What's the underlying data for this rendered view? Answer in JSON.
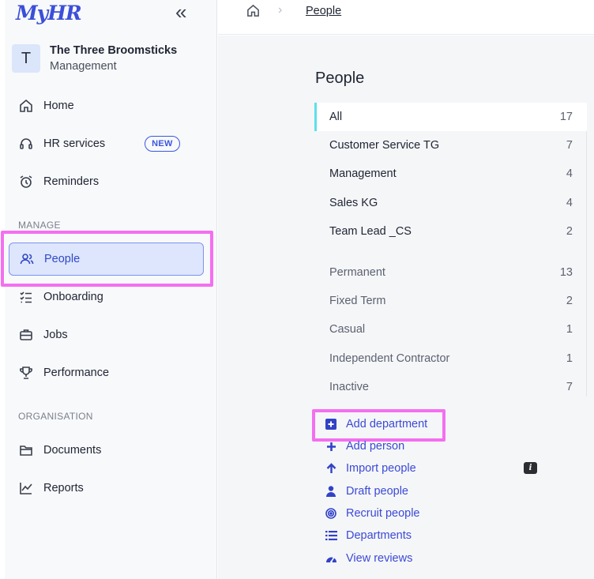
{
  "app": {
    "logo": "MyHR",
    "accent": "#3b4fd9"
  },
  "org": {
    "initial": "T",
    "name": "The Three Broomsticks",
    "role": "Management"
  },
  "nav": {
    "primary": [
      {
        "label": "Home",
        "icon": "home-icon"
      },
      {
        "label": "HR services",
        "icon": "headset-icon",
        "badge": "NEW"
      },
      {
        "label": "Reminders",
        "icon": "alarm-clock-icon"
      }
    ],
    "manage_label": "MANAGE",
    "manage": [
      {
        "label": "People",
        "icon": "people-icon",
        "active": true
      },
      {
        "label": "Onboarding",
        "icon": "checklist-icon"
      },
      {
        "label": "Jobs",
        "icon": "briefcase-icon"
      },
      {
        "label": "Performance",
        "icon": "trophy-icon"
      }
    ],
    "organisation_label": "ORGANISATION",
    "organisation": [
      {
        "label": "Documents",
        "icon": "folder-icon"
      },
      {
        "label": "Reports",
        "icon": "line-chart-icon"
      }
    ]
  },
  "breadcrumb": {
    "home_icon": "home-icon",
    "current": "People"
  },
  "page": {
    "title": "People"
  },
  "filters": {
    "all": {
      "label": "All",
      "count": "17"
    },
    "departments": [
      {
        "label": "Customer Service TG",
        "count": "7"
      },
      {
        "label": "Management",
        "count": "4"
      },
      {
        "label": "Sales KG",
        "count": "4"
      },
      {
        "label": "Team Lead _CS",
        "count": "2"
      }
    ],
    "types": [
      {
        "label": "Permanent",
        "count": "13"
      },
      {
        "label": "Fixed Term",
        "count": "2"
      },
      {
        "label": "Casual",
        "count": "1"
      },
      {
        "label": "Independent Contractor",
        "count": "1"
      },
      {
        "label": "Inactive",
        "count": "7"
      }
    ]
  },
  "actions": [
    {
      "label": "Add department",
      "icon": "plus-square-icon"
    },
    {
      "label": "Add person",
      "icon": "plus-icon"
    },
    {
      "label": "Import people",
      "icon": "arrow-up-icon"
    },
    {
      "label": "Draft people",
      "icon": "user-icon"
    },
    {
      "label": "Recruit people",
      "icon": "target-icon"
    },
    {
      "label": "Departments",
      "icon": "list-icon"
    },
    {
      "label": "View reviews",
      "icon": "gauge-icon"
    }
  ],
  "info_icon": "info-icon"
}
